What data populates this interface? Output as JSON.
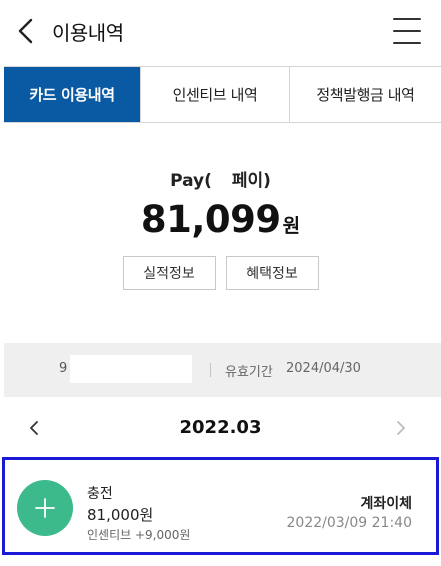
{
  "header": {
    "title": "이용내역",
    "back_icon": "chevron-left-icon",
    "menu_icon": "hamburger-menu-icon"
  },
  "tabs": [
    {
      "label": "카드 이용내역",
      "active": true
    },
    {
      "label": "인센티브 내역",
      "active": false
    },
    {
      "label": "정책발행금 내역",
      "active": false
    }
  ],
  "card": {
    "name_prefix": "Pay(",
    "name_suffix": "페이)",
    "balance": "81,099",
    "balance_unit": "원",
    "buttons": [
      "실적정보",
      "혜택정보"
    ],
    "number_prefix": "9",
    "expiry_label": "유효기간",
    "expiry_value": "2024/04/30"
  },
  "month_nav": {
    "current": "2022.03",
    "prev_icon": "chevron-left-icon",
    "next_icon": "chevron-right-icon"
  },
  "transactions": [
    {
      "icon": "plus-icon",
      "type": "충전",
      "amount": "81,000원",
      "incentive": "인센티브 +9,000원",
      "method": "계좌이체",
      "datetime": "2022/03/09 21:40"
    }
  ],
  "colors": {
    "accent": "#0a5aa3",
    "charge_icon": "#3cba8b",
    "highlight_border": "#1a1ad6"
  }
}
